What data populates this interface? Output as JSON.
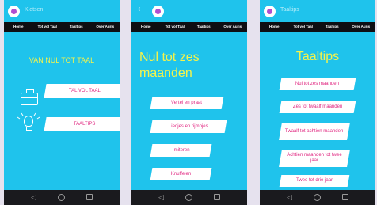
{
  "colors": {
    "accent": "#1fc3ec",
    "title_yellow": "#f5f34a",
    "button_text": "#e0247f",
    "tabbar": "#0e0e12"
  },
  "screens": [
    {
      "app_title": "Kletsen",
      "tabs": [
        "Home",
        "Tot vol Taal",
        "Taaltips",
        "Over Auris"
      ],
      "active_tab": 0,
      "heading": "VAN NUL TOT TAAL",
      "buttons": [
        "TAL VOL TAAL",
        "TAALTIPS"
      ]
    },
    {
      "tabs": [
        "Home",
        "Tot vol Taal",
        "Taaltips",
        "Over Auris"
      ],
      "active_tab": 1,
      "heading": "Nul tot zes maanden",
      "buttons": [
        "Vertel en praat",
        "Liedjes en rijmpjes",
        "Imiteren",
        "Knuffelen"
      ]
    },
    {
      "app_title": "Taaltips",
      "tabs": [
        "Home",
        "Tot vol Taal",
        "Taaltips",
        "Over Auris"
      ],
      "active_tab": 2,
      "heading": "Taaltips",
      "buttons": [
        "Nul tot zes maanden",
        "Zes tot twaalf maanden",
        "Twaalf tot achtien maanden",
        "Achtien maanden tot twee jaar",
        "Twee tot drie jaar"
      ]
    }
  ],
  "icons": [
    "back-arrow-icon",
    "home-circle-icon",
    "recent-square-icon",
    "briefcase-icon",
    "lightbulb-icon"
  ]
}
